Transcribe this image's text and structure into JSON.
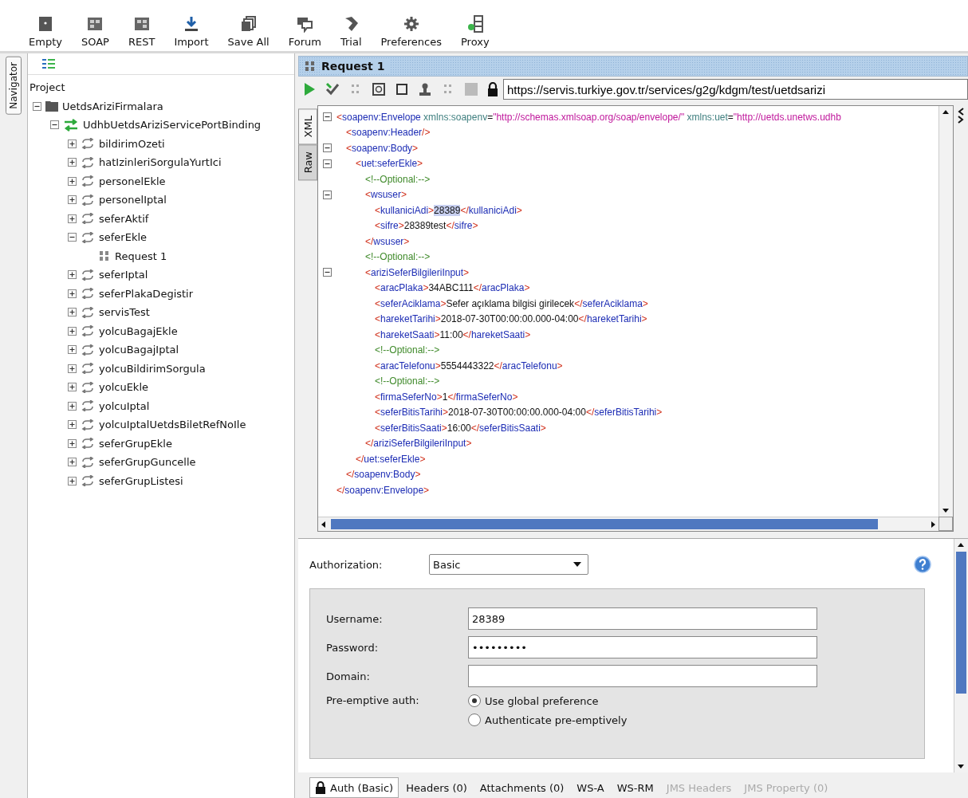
{
  "toolbar": [
    {
      "label": "Empty"
    },
    {
      "label": "SOAP"
    },
    {
      "label": "REST"
    },
    {
      "label": "Import"
    },
    {
      "label": "Save All"
    },
    {
      "label": "Forum"
    },
    {
      "label": "Trial"
    },
    {
      "label": "Preferences"
    },
    {
      "label": "Proxy"
    }
  ],
  "navigator": {
    "label": "Navigator"
  },
  "tree": {
    "label": "Project",
    "children": [
      {
        "label": "UetdsAriziFirmalara",
        "kind": "interface",
        "expanded": true,
        "children": [
          {
            "label": "UdhbUetdsAriziServicePortBinding",
            "kind": "binding",
            "expanded": true,
            "children": [
              {
                "label": "bildirimOzeti",
                "kind": "operation",
                "expanded": false
              },
              {
                "label": "hatIzinleriSorgulaYurtIci",
                "kind": "operation",
                "expanded": false
              },
              {
                "label": "personelEkle",
                "kind": "operation",
                "expanded": false
              },
              {
                "label": "personelIptal",
                "kind": "operation",
                "expanded": false
              },
              {
                "label": "seferAktif",
                "kind": "operation",
                "expanded": false
              },
              {
                "label": "seferEkle",
                "kind": "operation",
                "expanded": true,
                "children": [
                  {
                    "label": "Request 1",
                    "kind": "request"
                  }
                ]
              },
              {
                "label": "seferIptal",
                "kind": "operation",
                "expanded": false
              },
              {
                "label": "seferPlakaDegistir",
                "kind": "operation",
                "expanded": false
              },
              {
                "label": "servisTest",
                "kind": "operation",
                "expanded": false
              },
              {
                "label": "yolcuBagajEkle",
                "kind": "operation",
                "expanded": false
              },
              {
                "label": "yolcuBagajIptal",
                "kind": "operation",
                "expanded": false
              },
              {
                "label": "yolcuBildirimSorgula",
                "kind": "operation",
                "expanded": false
              },
              {
                "label": "yolcuEkle",
                "kind": "operation",
                "expanded": false
              },
              {
                "label": "yolcuIptal",
                "kind": "operation",
                "expanded": false
              },
              {
                "label": "yolcuIptalUetdsBiletRefNoIle",
                "kind": "operation",
                "expanded": false
              },
              {
                "label": "seferGrupEkle",
                "kind": "operation",
                "expanded": false
              },
              {
                "label": "seferGrupGuncelle",
                "kind": "operation",
                "expanded": false
              },
              {
                "label": "seferGrupListesi",
                "kind": "operation",
                "expanded": false
              }
            ]
          }
        ]
      }
    ]
  },
  "request": {
    "title": "Request 1",
    "url": "https://servis.turkiye.gov.tr/services/g2g/kdgm/test/uetdsarizi",
    "editor_tabs": [
      {
        "label": "XML",
        "selected": true
      },
      {
        "label": "Raw",
        "selected": false
      }
    ],
    "xml": [
      {
        "fold": true,
        "line": [
          {
            "kind": "br",
            "text": "<"
          },
          {
            "kind": "tag",
            "text": "soapenv:Envelope"
          },
          {
            "kind": "attr",
            "text": " xmlns:soapenv"
          },
          {
            "kind": "text",
            "text": "="
          },
          {
            "kind": "val",
            "text": "\"http://schemas.xmlsoap.org/soap/envelope/\""
          },
          {
            "kind": "attr",
            "text": " xmlns:uet"
          },
          {
            "kind": "text",
            "text": "="
          },
          {
            "kind": "val",
            "text": "\"http://uetds.unetws.udhb"
          }
        ],
        "end": [
          {
            "kind": "br",
            "text": "</"
          },
          {
            "kind": "tag",
            "text": "soapenv:Envelope"
          },
          {
            "kind": "br",
            "text": ">"
          }
        ],
        "children": [
          {
            "fold": false,
            "line": [
              {
                "kind": "br",
                "text": "<"
              },
              {
                "kind": "tag",
                "text": "soapenv:Header"
              },
              {
                "kind": "br",
                "text": "/>"
              }
            ]
          },
          {
            "fold": true,
            "line": [
              {
                "kind": "br",
                "text": "<"
              },
              {
                "kind": "tag",
                "text": "soapenv:Body"
              },
              {
                "kind": "br",
                "text": ">"
              }
            ],
            "end": [
              {
                "kind": "br",
                "text": "</"
              },
              {
                "kind": "tag",
                "text": "soapenv:Body"
              },
              {
                "kind": "br",
                "text": ">"
              }
            ],
            "children": [
              {
                "fold": true,
                "line": [
                  {
                    "kind": "br",
                    "text": "<"
                  },
                  {
                    "kind": "tag",
                    "text": "uet:seferEkle"
                  },
                  {
                    "kind": "br",
                    "text": ">"
                  }
                ],
                "end": [
                  {
                    "kind": "br",
                    "text": "</"
                  },
                  {
                    "kind": "tag",
                    "text": "uet:seferEkle"
                  },
                  {
                    "kind": "br",
                    "text": ">"
                  }
                ],
                "children": [
                  {
                    "fold": false,
                    "line": [
                      {
                        "kind": "comment",
                        "text": "<!--Optional:-->"
                      }
                    ]
                  },
                  {
                    "fold": true,
                    "line": [
                      {
                        "kind": "br",
                        "text": "<"
                      },
                      {
                        "kind": "tag",
                        "text": "wsuser"
                      },
                      {
                        "kind": "br",
                        "text": ">"
                      }
                    ],
                    "end": [
                      {
                        "kind": "br",
                        "text": "</"
                      },
                      {
                        "kind": "tag",
                        "text": "wsuser"
                      },
                      {
                        "kind": "br",
                        "text": ">"
                      }
                    ],
                    "children": [
                      {
                        "fold": false,
                        "line": [
                          {
                            "kind": "br",
                            "text": "<"
                          },
                          {
                            "kind": "tag",
                            "text": "kullaniciAdi"
                          },
                          {
                            "kind": "br",
                            "text": ">"
                          },
                          {
                            "kind": "sel",
                            "text": "28389"
                          },
                          {
                            "kind": "br",
                            "text": "</"
                          },
                          {
                            "kind": "tag",
                            "text": "kullaniciAdi"
                          },
                          {
                            "kind": "br",
                            "text": ">"
                          }
                        ]
                      },
                      {
                        "fold": false,
                        "line": [
                          {
                            "kind": "br",
                            "text": "<"
                          },
                          {
                            "kind": "tag",
                            "text": "sifre"
                          },
                          {
                            "kind": "br",
                            "text": ">"
                          },
                          {
                            "kind": "text",
                            "text": "28389test"
                          },
                          {
                            "kind": "br",
                            "text": "</"
                          },
                          {
                            "kind": "tag",
                            "text": "sifre"
                          },
                          {
                            "kind": "br",
                            "text": ">"
                          }
                        ]
                      }
                    ]
                  },
                  {
                    "fold": false,
                    "line": [
                      {
                        "kind": "comment",
                        "text": "<!--Optional:-->"
                      }
                    ]
                  },
                  {
                    "fold": true,
                    "line": [
                      {
                        "kind": "br",
                        "text": "<"
                      },
                      {
                        "kind": "tag",
                        "text": "ariziSeferBilgileriInput"
                      },
                      {
                        "kind": "br",
                        "text": ">"
                      }
                    ],
                    "end": [
                      {
                        "kind": "br",
                        "text": "</"
                      },
                      {
                        "kind": "tag",
                        "text": "ariziSeferBilgileriInput"
                      },
                      {
                        "kind": "br",
                        "text": ">"
                      }
                    ],
                    "children": [
                      {
                        "fold": false,
                        "line": [
                          {
                            "kind": "br",
                            "text": "<"
                          },
                          {
                            "kind": "tag",
                            "text": "aracPlaka"
                          },
                          {
                            "kind": "br",
                            "text": ">"
                          },
                          {
                            "kind": "text",
                            "text": "34ABC111"
                          },
                          {
                            "kind": "br",
                            "text": "</"
                          },
                          {
                            "kind": "tag",
                            "text": "aracPlaka"
                          },
                          {
                            "kind": "br",
                            "text": ">"
                          }
                        ]
                      },
                      {
                        "fold": false,
                        "line": [
                          {
                            "kind": "br",
                            "text": "<"
                          },
                          {
                            "kind": "tag",
                            "text": "seferAciklama"
                          },
                          {
                            "kind": "br",
                            "text": ">"
                          },
                          {
                            "kind": "text",
                            "text": "Sefer açıklama bilgisi girilecek"
                          },
                          {
                            "kind": "br",
                            "text": "</"
                          },
                          {
                            "kind": "tag",
                            "text": "seferAciklama"
                          },
                          {
                            "kind": "br",
                            "text": ">"
                          }
                        ]
                      },
                      {
                        "fold": false,
                        "line": [
                          {
                            "kind": "br",
                            "text": "<"
                          },
                          {
                            "kind": "tag",
                            "text": "hareketTarihi"
                          },
                          {
                            "kind": "br",
                            "text": ">"
                          },
                          {
                            "kind": "text",
                            "text": "2018-07-30T00:00:00.000-04:00"
                          },
                          {
                            "kind": "br",
                            "text": "</"
                          },
                          {
                            "kind": "tag",
                            "text": "hareketTarihi"
                          },
                          {
                            "kind": "br",
                            "text": ">"
                          }
                        ]
                      },
                      {
                        "fold": false,
                        "line": [
                          {
                            "kind": "br",
                            "text": "<"
                          },
                          {
                            "kind": "tag",
                            "text": "hareketSaati"
                          },
                          {
                            "kind": "br",
                            "text": ">"
                          },
                          {
                            "kind": "text",
                            "text": "11:00"
                          },
                          {
                            "kind": "br",
                            "text": "</"
                          },
                          {
                            "kind": "tag",
                            "text": "hareketSaati"
                          },
                          {
                            "kind": "br",
                            "text": ">"
                          }
                        ]
                      },
                      {
                        "fold": false,
                        "line": [
                          {
                            "kind": "comment",
                            "text": "<!--Optional:-->"
                          }
                        ]
                      },
                      {
                        "fold": false,
                        "line": [
                          {
                            "kind": "br",
                            "text": "<"
                          },
                          {
                            "kind": "tag",
                            "text": "aracTelefonu"
                          },
                          {
                            "kind": "br",
                            "text": ">"
                          },
                          {
                            "kind": "text",
                            "text": "5554443322"
                          },
                          {
                            "kind": "br",
                            "text": "</"
                          },
                          {
                            "kind": "tag",
                            "text": "aracTelefonu"
                          },
                          {
                            "kind": "br",
                            "text": ">"
                          }
                        ]
                      },
                      {
                        "fold": false,
                        "line": [
                          {
                            "kind": "comment",
                            "text": "<!--Optional:-->"
                          }
                        ]
                      },
                      {
                        "fold": false,
                        "line": [
                          {
                            "kind": "br",
                            "text": "<"
                          },
                          {
                            "kind": "tag",
                            "text": "firmaSeferNo"
                          },
                          {
                            "kind": "br",
                            "text": ">"
                          },
                          {
                            "kind": "text",
                            "text": "1"
                          },
                          {
                            "kind": "br",
                            "text": "</"
                          },
                          {
                            "kind": "tag",
                            "text": "firmaSeferNo"
                          },
                          {
                            "kind": "br",
                            "text": ">"
                          }
                        ]
                      },
                      {
                        "fold": false,
                        "line": [
                          {
                            "kind": "br",
                            "text": "<"
                          },
                          {
                            "kind": "tag",
                            "text": "seferBitisTarihi"
                          },
                          {
                            "kind": "br",
                            "text": ">"
                          },
                          {
                            "kind": "text",
                            "text": "2018-07-30T00:00:00.000-04:00"
                          },
                          {
                            "kind": "br",
                            "text": "</"
                          },
                          {
                            "kind": "tag",
                            "text": "seferBitisTarihi"
                          },
                          {
                            "kind": "br",
                            "text": ">"
                          }
                        ]
                      },
                      {
                        "fold": false,
                        "line": [
                          {
                            "kind": "br",
                            "text": "<"
                          },
                          {
                            "kind": "tag",
                            "text": "seferBitisSaati"
                          },
                          {
                            "kind": "br",
                            "text": ">"
                          },
                          {
                            "kind": "text",
                            "text": "16:00"
                          },
                          {
                            "kind": "br",
                            "text": "</"
                          },
                          {
                            "kind": "tag",
                            "text": "seferBitisSaati"
                          },
                          {
                            "kind": "br",
                            "text": ">"
                          }
                        ]
                      }
                    ]
                  }
                ]
              }
            ]
          }
        ]
      }
    ]
  },
  "auth": {
    "label": "Authorization:",
    "type": "Basic",
    "fields": [
      {
        "label": "Username:",
        "value": "28389"
      },
      {
        "label": "Password:",
        "value": "•••••••••"
      },
      {
        "label": "Domain:"
      }
    ],
    "preemptive": {
      "label": "Pre-emptive auth:",
      "options": [
        {
          "label": "Use global preference",
          "selected": true
        },
        {
          "label": "Authenticate pre-emptively",
          "selected": false
        }
      ]
    }
  },
  "bottom_tabs": [
    {
      "label": "Auth (Basic)",
      "kind": "auth",
      "selected": true,
      "disabled": false
    },
    {
      "label": "Headers (0)",
      "kind": "plain",
      "selected": false,
      "disabled": false
    },
    {
      "label": "Attachments (0)",
      "kind": "plain",
      "selected": false,
      "disabled": false
    },
    {
      "label": "WS-A",
      "kind": "plain",
      "selected": false,
      "disabled": false
    },
    {
      "label": "WS-RM",
      "kind": "plain",
      "selected": false,
      "disabled": false
    },
    {
      "label": "JMS Headers",
      "kind": "plain",
      "selected": false,
      "disabled": true
    },
    {
      "label": "JMS Property (0)",
      "kind": "plain",
      "selected": false,
      "disabled": true
    }
  ]
}
